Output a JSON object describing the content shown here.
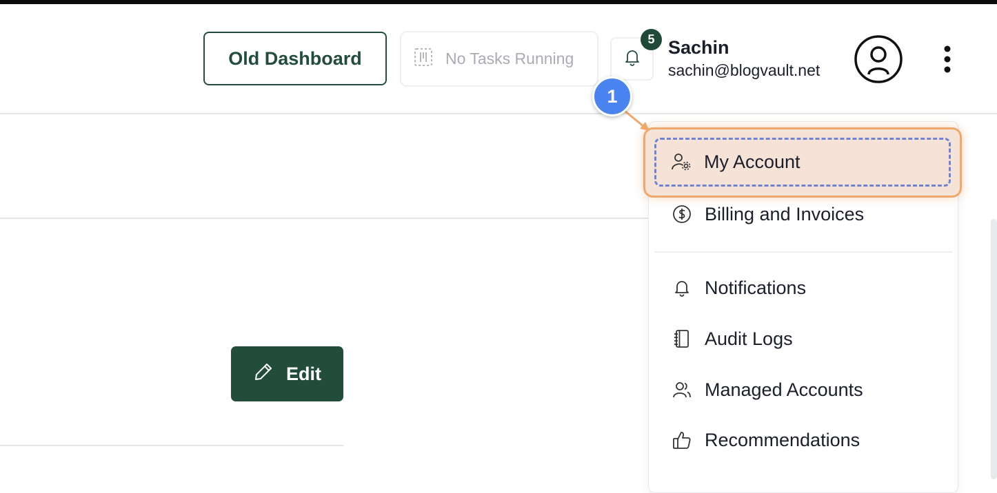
{
  "header": {
    "old_dashboard_label": "Old Dashboard",
    "tasks_label": "No Tasks Running",
    "notification_count": "5",
    "user": {
      "name": "Sachin",
      "email": "sachin@blogvault.net"
    }
  },
  "step_marker": "1",
  "user_menu": {
    "items": [
      {
        "label": "My Account",
        "icon": "user-gear-icon",
        "highlighted": true
      },
      {
        "label": "Billing and Invoices",
        "icon": "dollar-circle-icon"
      },
      {
        "label": "Notifications",
        "icon": "bell-icon"
      },
      {
        "label": "Audit Logs",
        "icon": "notebook-icon"
      },
      {
        "label": "Managed Accounts",
        "icon": "users-icon"
      },
      {
        "label": "Recommendations",
        "icon": "thumbs-up-icon"
      }
    ]
  },
  "content": {
    "edit_label": "Edit"
  },
  "colors": {
    "brand": "#224d3b",
    "highlight": "#f0a76a",
    "marker": "#4a84f0"
  }
}
